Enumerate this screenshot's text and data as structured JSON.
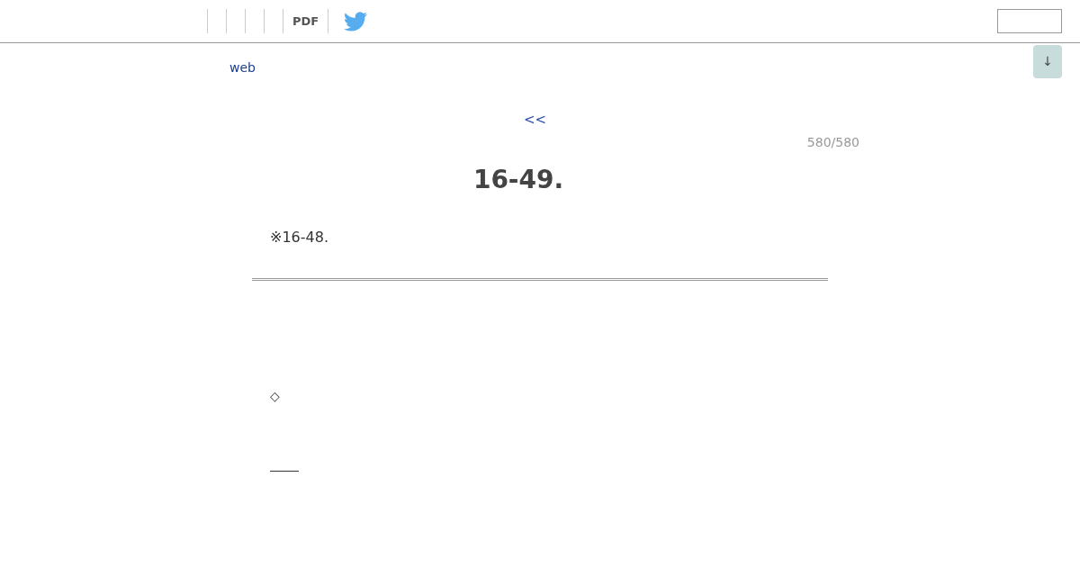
{
  "header": {
    "pdf_link": "PDF",
    "scroll_button": "↓"
  },
  "breadcrumb": {
    "link": "web"
  },
  "pager": {
    "prev_link": "<<",
    "position": "580/580"
  },
  "article": {
    "title": "16-49.",
    "note": "※16-48.",
    "bullet": "◇"
  }
}
